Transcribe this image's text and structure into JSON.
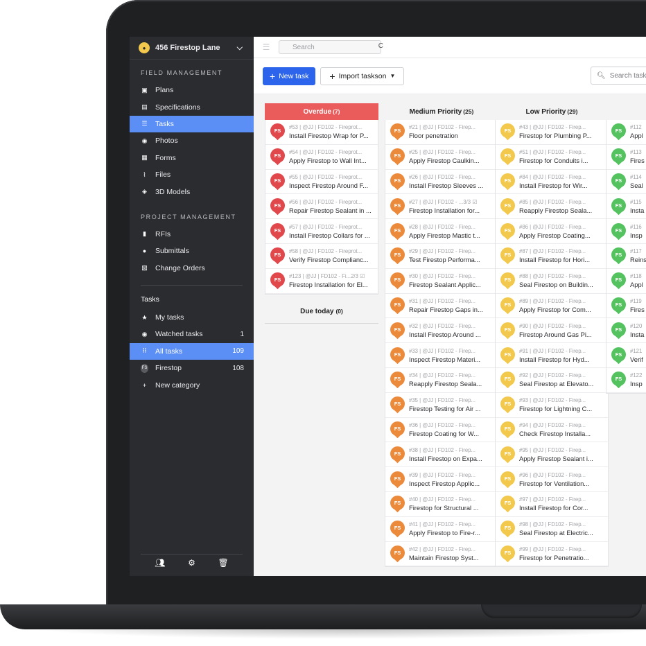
{
  "project": {
    "name": "456 Firestop Lane"
  },
  "sidebar": {
    "field_title": "FIELD MANAGEMENT",
    "field_items": [
      {
        "label": "Plans",
        "icon": "plans-icon"
      },
      {
        "label": "Specifications",
        "icon": "specifications-icon"
      },
      {
        "label": "Tasks",
        "icon": "tasks-icon",
        "active": true
      },
      {
        "label": "Photos",
        "icon": "camera-icon"
      },
      {
        "label": "Forms",
        "icon": "clipboard-icon"
      },
      {
        "label": "Files",
        "icon": "paperclip-icon"
      },
      {
        "label": "3D Models",
        "icon": "cube-icon"
      }
    ],
    "project_title": "PROJECT MANAGEMENT",
    "project_items": [
      {
        "label": "RFIs",
        "icon": "rfi-icon"
      },
      {
        "label": "Submittals",
        "icon": "person-icon"
      },
      {
        "label": "Change Orders",
        "icon": "change-orders-icon"
      }
    ],
    "tasks_title": "Tasks",
    "task_items": [
      {
        "label": "My tasks",
        "icon": "star-icon",
        "count": ""
      },
      {
        "label": "Watched tasks",
        "icon": "eye-icon",
        "count": "1"
      },
      {
        "label": "All tasks",
        "icon": "grid-icon",
        "count": "109",
        "active": true
      },
      {
        "label": "Firestop",
        "icon": "fs-badge-icon",
        "count": "108"
      },
      {
        "label": "New category",
        "icon": "plus-icon",
        "count": ""
      }
    ],
    "fs_badge": "FS"
  },
  "topbar": {
    "search_placeholder": "Search"
  },
  "toolbar": {
    "new_task": "New task",
    "import_tasks": "Import taskson",
    "search_tasks": "Search task"
  },
  "colors": {
    "overdue": "#e0484c",
    "medium": "#ec8a3c",
    "low": "#f2c94c",
    "high": "#53c25f"
  },
  "columns": [
    {
      "title": "Overdue",
      "count": "(7)",
      "color": "#e0484c",
      "cards": [
        {
          "meta": "#53 | @JJ | FD102 - Fireprot...",
          "title": "Install Firestop Wrap for P..."
        },
        {
          "meta": "#54 | @JJ | FD102 - Fireprot...",
          "title": "Apply Firestop to Wall Int..."
        },
        {
          "meta": "#55 | @JJ | FD102 - Fireprot...",
          "title": "Inspect Firestop Around F..."
        },
        {
          "meta": "#56 | @JJ | FD102 - Fireprot...",
          "title": "Repair Firestop Sealant in ..."
        },
        {
          "meta": "#57 | @JJ | FD102 - Fireprot...",
          "title": "Install Firestop Collars for ..."
        },
        {
          "meta": "#58 | @JJ | FD102 - Fireprot...",
          "title": "Verify Firestop Complianc..."
        },
        {
          "meta": "#123 | @JJ | FD102 - Fi...2/3 ☑",
          "title": "Firestop Installation for El..."
        }
      ],
      "sub_title": "Due today",
      "sub_count": "(0)"
    },
    {
      "title": "Medium Priority",
      "count": "(25)",
      "color": "#ec8a3c",
      "cards": [
        {
          "meta": "#21 | @JJ | FD102 - Firep...",
          "title": "Floor penetration"
        },
        {
          "meta": "#25 | @JJ | FD102 - Firep...",
          "title": "Apply Firestop Caulkin..."
        },
        {
          "meta": "#26 | @JJ | FD102 - Firep...",
          "title": "Install Firestop Sleeves ..."
        },
        {
          "meta": "#27 | @JJ | FD102 - ...3/3 ☑",
          "title": "Firestop Installation for..."
        },
        {
          "meta": "#28 | @JJ | FD102 - Firep...",
          "title": "Apply Firestop Mastic t..."
        },
        {
          "meta": "#29 | @JJ | FD102 - Firep...",
          "title": "Test Firestop Performa..."
        },
        {
          "meta": "#30 | @JJ | FD102 - Firep...",
          "title": "Firestop Sealant Applic..."
        },
        {
          "meta": "#31 | @JJ | FD102 - Firep...",
          "title": "Repair Firestop Gaps in..."
        },
        {
          "meta": "#32 | @JJ | FD102 - Firep...",
          "title": "Install Firestop Around ..."
        },
        {
          "meta": "#33 | @JJ | FD102 - Firep...",
          "title": "Inspect Firestop Materi..."
        },
        {
          "meta": "#34 | @JJ | FD102 - Firep...",
          "title": "Reapply Firestop Seala..."
        },
        {
          "meta": "#35 | @JJ | FD102 - Firep...",
          "title": "Firestop Testing for Air ..."
        },
        {
          "meta": "#36 | @JJ | FD102 - Firep...",
          "title": "Firestop Coating for W..."
        },
        {
          "meta": "#38 | @JJ | FD102 - Firep...",
          "title": "Install Firestop on Expa..."
        },
        {
          "meta": "#39 | @JJ | FD102 - Firep...",
          "title": "Inspect Firestop Applic..."
        },
        {
          "meta": "#40 | @JJ | FD102 - Firep...",
          "title": "Firestop for Structural ..."
        },
        {
          "meta": "#41 | @JJ | FD102 - Firep...",
          "title": "Apply Firestop to Fire-r..."
        },
        {
          "meta": "#42 | @JJ | FD102 - Firep...",
          "title": "Maintain Firestop Syst..."
        }
      ]
    },
    {
      "title": "Low Priority",
      "count": "(29)",
      "color": "#f2c94c",
      "cards": [
        {
          "meta": "#43 | @JJ | FD102 - Firep...",
          "title": "Firestop for Plumbing P..."
        },
        {
          "meta": "#51 | @JJ | FD102 - Firep...",
          "title": "Firestop for Conduits i..."
        },
        {
          "meta": "#84 | @JJ | FD102 - Firep...",
          "title": "Install Firestop for Wir..."
        },
        {
          "meta": "#85 | @JJ | FD102 - Firep...",
          "title": "Reapply Firestop Seala..."
        },
        {
          "meta": "#86 | @JJ | FD102 - Firep...",
          "title": "Apply Firestop Coating..."
        },
        {
          "meta": "#87 | @JJ | FD102 - Firep...",
          "title": "Install Firestop for Hori..."
        },
        {
          "meta": "#88 | @JJ | FD102 - Firep...",
          "title": "Seal Firestop on Buildin..."
        },
        {
          "meta": "#89 | @JJ | FD102 - Firep...",
          "title": "Apply Firestop for Com..."
        },
        {
          "meta": "#90 | @JJ | FD102 - Firep...",
          "title": "Firestop Around Gas Pi..."
        },
        {
          "meta": "#91 | @JJ | FD102 - Firep...",
          "title": "Install Firestop for Hyd..."
        },
        {
          "meta": "#92 | @JJ | FD102 - Firep...",
          "title": "Seal Firestop at Elevato..."
        },
        {
          "meta": "#93 | @JJ | FD102 - Firep...",
          "title": "Firestop for Lightning C..."
        },
        {
          "meta": "#94 | @JJ | FD102 - Firep...",
          "title": "Check Firestop Installa..."
        },
        {
          "meta": "#95 | @JJ | FD102 - Firep...",
          "title": "Apply Firestop Sealant i..."
        },
        {
          "meta": "#96 | @JJ | FD102 - Firep...",
          "title": "Firestop for Ventilation..."
        },
        {
          "meta": "#97 | @JJ | FD102 - Firep...",
          "title": "Install Firestop for Cor..."
        },
        {
          "meta": "#98 | @JJ | FD102 - Firep...",
          "title": "Seal Firestop at Electric..."
        },
        {
          "meta": "#99 | @JJ | FD102 - Firep...",
          "title": "Firestop for Penetratio..."
        }
      ]
    },
    {
      "title": "",
      "count": "",
      "color": "#53c25f",
      "cards": [
        {
          "meta": "#112",
          "title": "Appl"
        },
        {
          "meta": "#113",
          "title": "Fires"
        },
        {
          "meta": "#114",
          "title": "Seal"
        },
        {
          "meta": "#115",
          "title": "Insta"
        },
        {
          "meta": "#116",
          "title": "Insp"
        },
        {
          "meta": "#117",
          "title": "Reins"
        },
        {
          "meta": "#118",
          "title": "Appl"
        },
        {
          "meta": "#119",
          "title": "Fires"
        },
        {
          "meta": "#120",
          "title": "Insta"
        },
        {
          "meta": "#121",
          "title": "Verif"
        },
        {
          "meta": "#122",
          "title": "Insp"
        }
      ]
    }
  ]
}
